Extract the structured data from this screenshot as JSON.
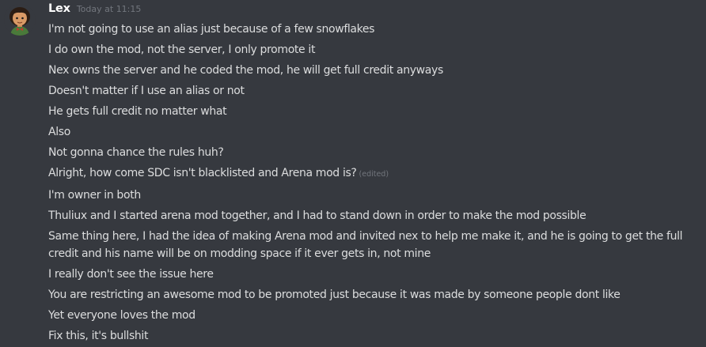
{
  "author": {
    "name": "Lex",
    "timestamp": "Today at 11:15",
    "avatar_icon": "cartoon-character-avatar-icon"
  },
  "messages": [
    {
      "text": "I'm not going to use an alias just because of a few snowflakes"
    },
    {
      "text": "I do own the mod, not the server, I only promote it"
    },
    {
      "text": "Nex owns the server and he coded the mod, he will get full credit anyways"
    },
    {
      "text": "Doesn't matter if I use an alias or not"
    },
    {
      "text": "He gets full credit no matter what"
    },
    {
      "text": "Also"
    },
    {
      "text": "Not gonna chance the rules huh?"
    },
    {
      "text": "Alright, how come SDC isn't blacklisted and Arena mod is?",
      "edited": "(edited)"
    },
    {
      "text": "I'm owner in both"
    },
    {
      "text": "Thuliux and I started arena mod together, and I had to stand down in order to make the mod possible"
    },
    {
      "text": "Same thing here, I had the idea of making Arena mod and invited nex to help me make it, and he is going to get the full credit and his name will be on modding space if it ever gets in, not mine"
    },
    {
      "text": "I really don't see the issue here"
    },
    {
      "text": "You are restricting an awesome mod to be promoted just because it was made by someone people dont like"
    },
    {
      "text": "Yet everyone loves the mod"
    },
    {
      "text": "Fix this, it's bullshit"
    }
  ],
  "colors": {
    "background": "#36393f",
    "username": "#ffffff",
    "message_text": "#dcddde",
    "muted": "#72767d"
  }
}
